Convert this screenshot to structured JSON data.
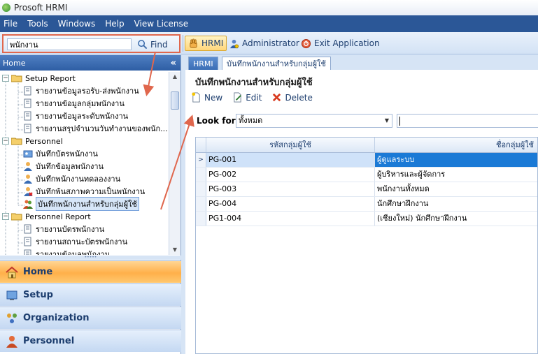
{
  "app": {
    "title": "Prosoft HRMI"
  },
  "menu": [
    "File",
    "Tools",
    "Windows",
    "Help",
    "View License"
  ],
  "search": {
    "value": "พนักงาน",
    "find_label": "Find"
  },
  "toolbar": {
    "hrmi_label": "HRMI",
    "admin_label": "Administrator",
    "exit_label": "Exit Application"
  },
  "left_panel": {
    "header": "Home",
    "collapse": "«",
    "tree": [
      {
        "label": "Setup Report",
        "level": 0,
        "expander": "−"
      },
      {
        "label": "รายงานข้อมูลรอรับ-ส่งพนักงาน",
        "level": 1
      },
      {
        "label": "รายงานข้อมูลกลุ่มพนักงาน",
        "level": 1
      },
      {
        "label": "รายงานข้อมูลระดับพนักงาน",
        "level": 1
      },
      {
        "label": "รายงานสรุปจำนวนวันทำงานของพนัก...",
        "level": 1
      },
      {
        "label": "Personnel",
        "level": 0,
        "expander": "−"
      },
      {
        "label": "บันทึกบัตรพนักงาน",
        "level": 1
      },
      {
        "label": "บันทึกข้อมูลพนักงาน",
        "level": 1
      },
      {
        "label": "บันทึกพนักงานทดลองงาน",
        "level": 1
      },
      {
        "label": "บันทึกพ้นสภาพความเป็นพนักงาน",
        "level": 1
      },
      {
        "label": "บันทึกพนักงานสำหรับกลุ่มผู้ใช้",
        "level": 1,
        "selected": true
      },
      {
        "label": "Personnel Report",
        "level": 0,
        "expander": "−"
      },
      {
        "label": "รายงานบัตรพนักงาน",
        "level": 1
      },
      {
        "label": "รายงานสถานะบัตรพนักงาน",
        "level": 1
      },
      {
        "label": "รายงานข้อมูลพนักงาน",
        "level": 1
      }
    ],
    "nav": [
      {
        "label": "Home",
        "active": true
      },
      {
        "label": "Setup",
        "active": false
      },
      {
        "label": "Organization",
        "active": false
      },
      {
        "label": "Personnel",
        "active": false
      }
    ]
  },
  "content": {
    "tabs": {
      "home_tab": "HRMI",
      "current_tab": "บันทึกพนักงานสำหรับกลุ่มผู้ใช้"
    },
    "form_title": "บันทึกพนักงานสำหรับกลุ่มผู้ใช้",
    "actions": {
      "new": "New",
      "edit": "Edit",
      "delete": "Delete"
    },
    "look_for": {
      "label": "Look for",
      "selected": "ทั้งหมด",
      "value": ""
    },
    "grid": {
      "columns": [
        "รหัสกลุ่มผู้ใช้",
        "ชื่อกลุ่มผู้ใช้"
      ],
      "rows": [
        {
          "code": "PG-001",
          "name": "ผู้ดูแลระบบ",
          "selected": true
        },
        {
          "code": "PG-002",
          "name": "ผู้บริหารและผู้จัดการ"
        },
        {
          "code": "PG-003",
          "name": "พนักงานทั้งหมด"
        },
        {
          "code": "PG-004",
          "name": "นักศึกษาฝึกงาน"
        },
        {
          "code": "PG1-004",
          "name": "(เชียงใหม่) นักศึกษาฝึกงาน"
        }
      ]
    }
  },
  "colors": {
    "menubar": "#2b5797",
    "highlight": "#e0674d",
    "selection": "#1b7ad6",
    "nav_active": "#ffb04a"
  }
}
